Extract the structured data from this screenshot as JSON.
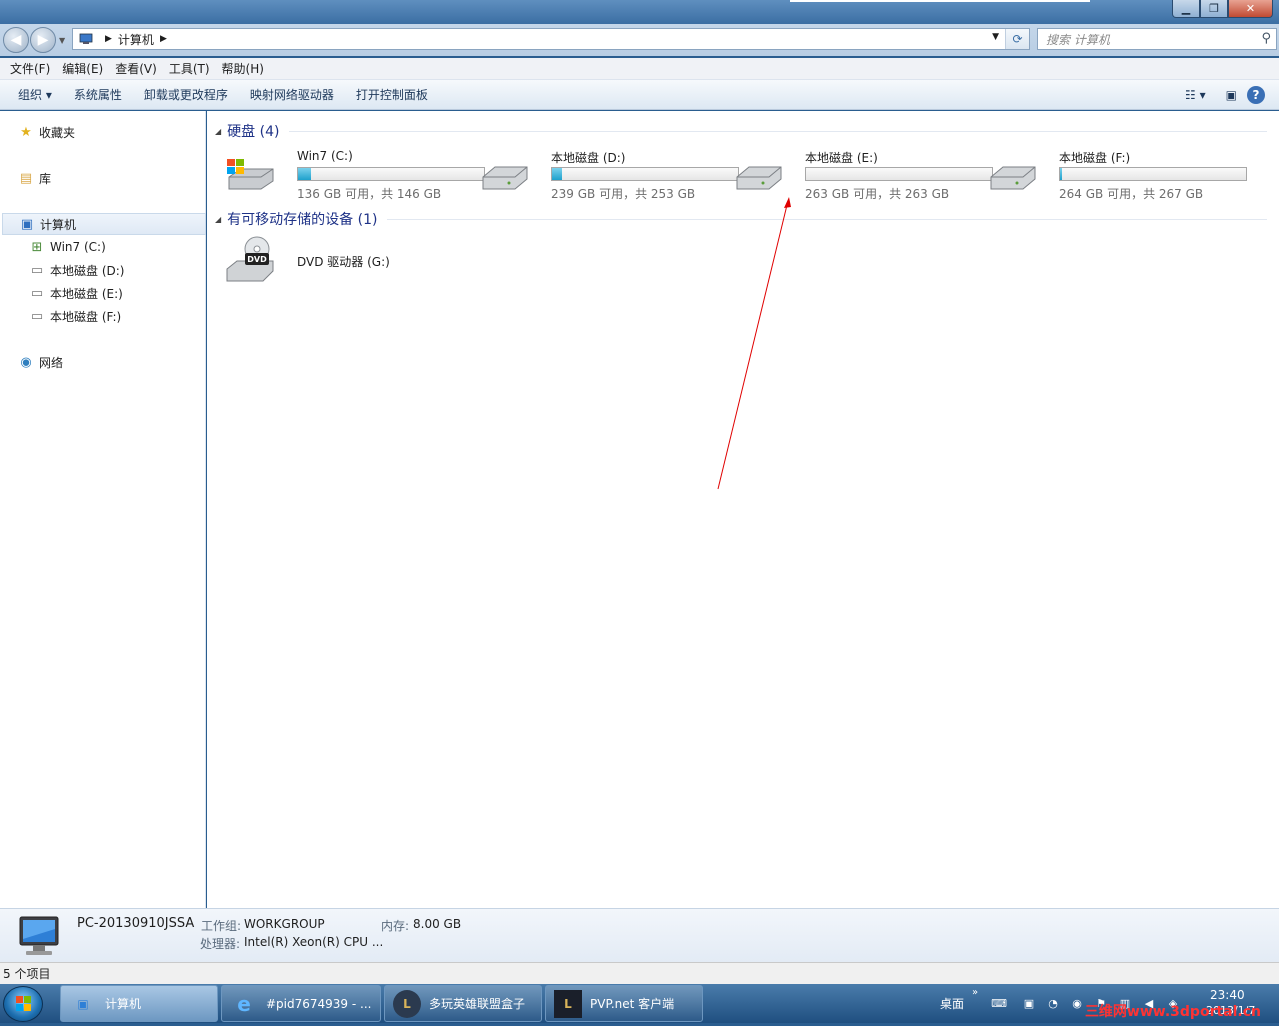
{
  "window": {
    "minimize": "▁",
    "maximize": "❐",
    "close": "✕"
  },
  "address": {
    "path": "计算机",
    "search_placeholder": "搜索 计算机"
  },
  "menu": [
    "文件(F)",
    "编辑(E)",
    "查看(V)",
    "工具(T)",
    "帮助(H)"
  ],
  "commands": {
    "organize": "组织 ▾",
    "items": [
      "系统属性",
      "卸载或更改程序",
      "映射网络驱动器",
      "打开控制面板"
    ]
  },
  "nav": {
    "favorites": "收藏夹",
    "libraries": "库",
    "computer": "计算机",
    "drives": [
      "Win7 (C:)",
      "本地磁盘 (D:)",
      "本地磁盘 (E:)",
      "本地磁盘 (F:)"
    ],
    "network": "网络"
  },
  "groups": {
    "hard_disks": "硬盘 (4)",
    "removable": "有可移动存储的设备 (1)"
  },
  "drives": [
    {
      "name": "Win7 (C:)",
      "info": "136 GB 可用，共 146 GB",
      "used_fraction": 0.07
    },
    {
      "name": "本地磁盘 (D:)",
      "info": "239 GB 可用，共 253 GB",
      "used_fraction": 0.055
    },
    {
      "name": "本地磁盘 (E:)",
      "info": "263 GB 可用，共 263 GB",
      "used_fraction": 0.0
    },
    {
      "name": "本地磁盘 (F:)",
      "info": "264 GB 可用，共 267 GB",
      "used_fraction": 0.011
    }
  ],
  "dvd": {
    "name": "DVD 驱动器 (G:)",
    "icon_label": "DVD"
  },
  "details": {
    "pc_name": "PC-20130910JSSA",
    "workgroup_label": "工作组:",
    "workgroup": "WORKGROUP",
    "memory_label": "内存:",
    "memory": "8.00 GB",
    "cpu_label": "处理器:",
    "cpu": "Intel(R) Xeon(R) CPU ..."
  },
  "status": "5 个项目",
  "taskbar": {
    "buttons": [
      "计算机",
      "#pid7674939 - ...",
      "多玩英雄联盟盒子",
      "PVP.net 客户端"
    ],
    "desktop": "桌面",
    "time": "23:40",
    "date": "2013/1/7",
    "watermark": "三维网www.3dportal.cn"
  },
  "colors": {
    "accent": "#1e3287",
    "bar_fill": "#1ea1cc",
    "annotation_arrow": "#e00000"
  }
}
